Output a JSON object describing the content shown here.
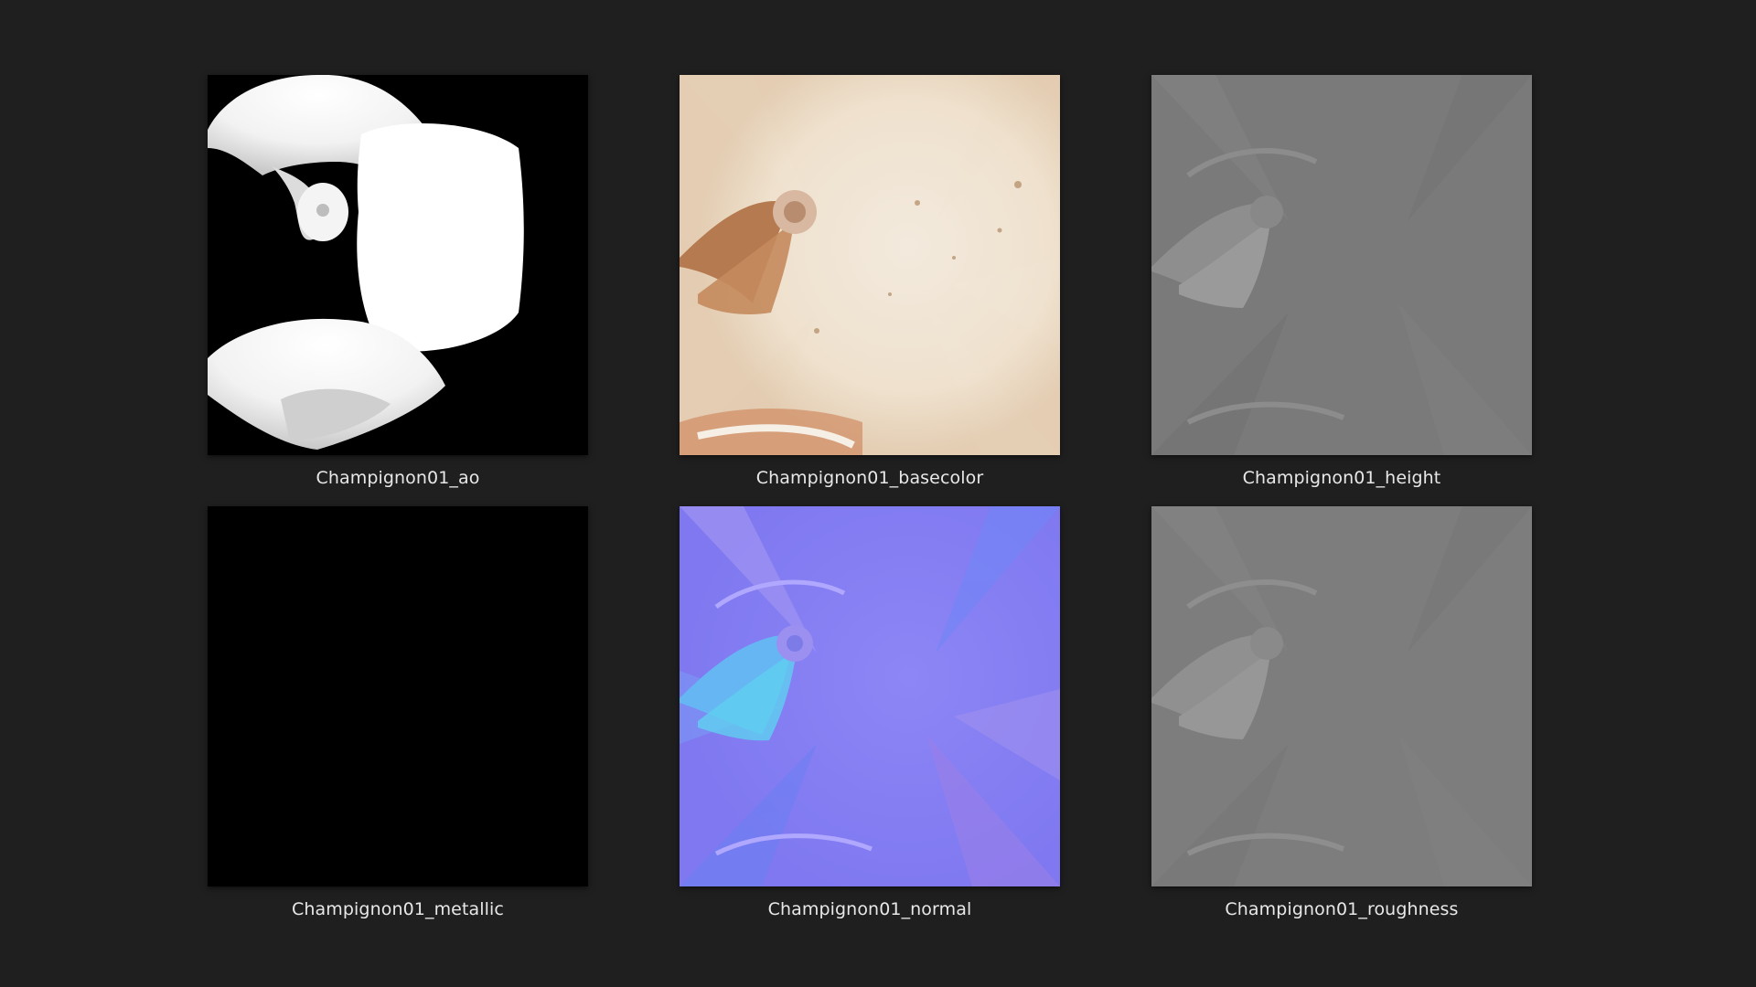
{
  "files": [
    {
      "name": "Champignon01_ao",
      "icon": "ao-map-thumbnail"
    },
    {
      "name": "Champignon01_basecolor",
      "icon": "basecolor-map-thumbnail"
    },
    {
      "name": "Champignon01_height",
      "icon": "height-map-thumbnail"
    },
    {
      "name": "Champignon01_metallic",
      "icon": "metallic-map-thumbnail"
    },
    {
      "name": "Champignon01_normal",
      "icon": "normal-map-thumbnail"
    },
    {
      "name": "Champignon01_roughness",
      "icon": "roughness-map-thumbnail"
    }
  ],
  "colors": {
    "background": "#1f1f1f",
    "label": "#e8e8e8"
  }
}
